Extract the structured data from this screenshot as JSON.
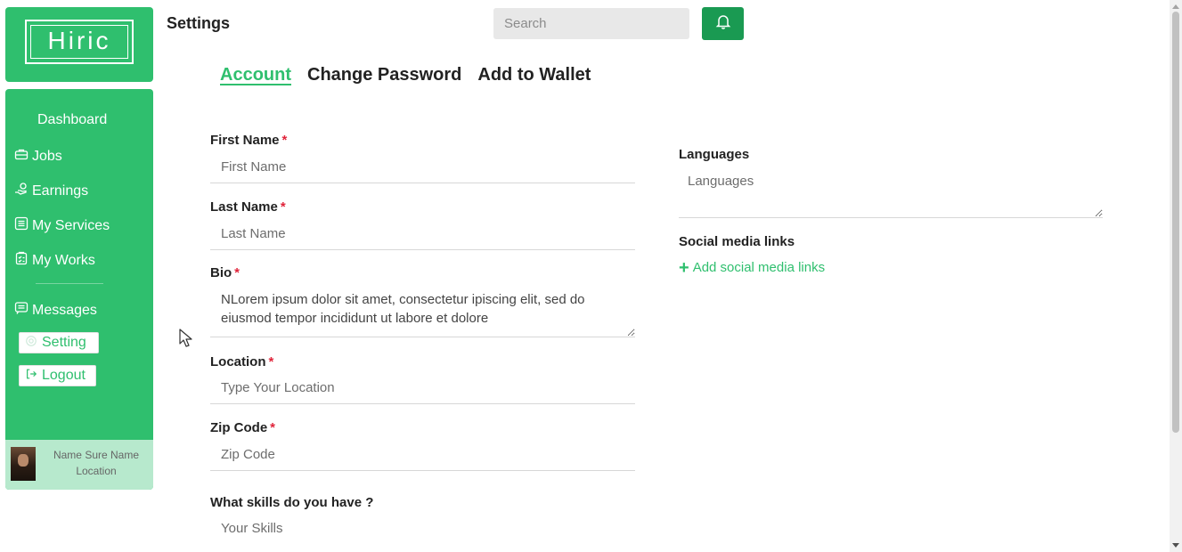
{
  "logo": {
    "text": "Hiric"
  },
  "sidebar": {
    "dashboard": "Dashboard",
    "items": [
      {
        "label": "Jobs",
        "icon": "briefcase-icon"
      },
      {
        "label": "Earnings",
        "icon": "earnings-icon"
      },
      {
        "label": "My Services",
        "icon": "list-icon"
      },
      {
        "label": "My Works",
        "icon": "clipboard-icon"
      },
      {
        "label": "Messages",
        "icon": "message-icon"
      }
    ],
    "setting_label": "Setting",
    "logout_label": "Logout",
    "profile": {
      "name": "Name Sure Name",
      "location": "Location"
    }
  },
  "header": {
    "title": "Settings",
    "search_placeholder": "Search",
    "bell_icon": "bell-icon"
  },
  "tabs": [
    {
      "label": "Account",
      "active": true
    },
    {
      "label": "Change Password",
      "active": false
    },
    {
      "label": "Add to Wallet",
      "active": false
    }
  ],
  "form": {
    "first_name": {
      "label": "First Name",
      "required": "*",
      "placeholder": "First Name"
    },
    "last_name": {
      "label": "Last Name",
      "required": "*",
      "placeholder": "Last Name"
    },
    "bio": {
      "label": "Bio",
      "required": "*",
      "value": "NLorem ipsum dolor sit amet, consectetur ipiscing elit, sed do eiusmod tempor incididunt ut labore et dolore"
    },
    "location": {
      "label": "Location",
      "required": "*",
      "placeholder": "Type Your Location"
    },
    "zip_code": {
      "label": "Zip Code",
      "required": "*",
      "placeholder": "Zip Code"
    },
    "skills": {
      "label": "What skills do you have ?",
      "placeholder": "Your Skills"
    },
    "languages": {
      "label": "Languages",
      "placeholder": "Languages"
    },
    "social": {
      "label": "Social media links",
      "add_label": "Add social media links"
    }
  },
  "colors": {
    "accent": "#2fbf6e",
    "accent_dark": "#1a9a52",
    "required": "#e0243a"
  }
}
